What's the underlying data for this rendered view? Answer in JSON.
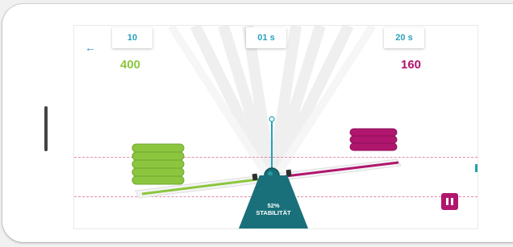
{
  "header": {
    "back_icon": "arrow-left-icon",
    "left_chip": "10",
    "center_chip": "01 s",
    "right_chip": "20 s",
    "left_score": "400",
    "right_score": "160"
  },
  "stability": {
    "value": "52%",
    "label": "STABILITÄT"
  },
  "controls": {
    "pause_icon": "pause-icon"
  },
  "colors": {
    "green": "#8cc63f",
    "magenta": "#b0166e",
    "teal": "#19707a",
    "accent": "#2aa0bf"
  }
}
